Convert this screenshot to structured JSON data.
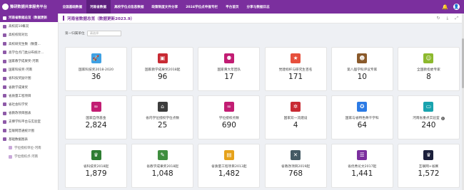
{
  "app": {
    "title": "豫研数据共享服务平台"
  },
  "nav": [
    {
      "label": "全国基础数据",
      "active": false
    },
    {
      "label": "河南省数据",
      "active": true
    },
    {
      "label": "高校学位点信息数据",
      "active": false
    },
    {
      "label": "政策制度文件分享",
      "active": false
    },
    {
      "label": "2024学位点申报专栏",
      "active": false
    },
    {
      "label": "平台首页",
      "active": false
    },
    {
      "label": "分享与数据日志",
      "active": false
    }
  ],
  "sidebar": [
    {
      "label": "河南省数据总览（数据更新",
      "active": true,
      "sub": false
    },
    {
      "label": "高校前10概况",
      "active": false,
      "sub": false
    },
    {
      "label": "高校校际对比",
      "active": false,
      "sub": false
    },
    {
      "label": "高校研究生数（数量...",
      "active": false,
      "sub": false
    },
    {
      "label": "高学位点门类分布统计...",
      "active": false,
      "sub": false
    },
    {
      "label": "国家教学成果奖-河南",
      "active": false,
      "sub": false
    },
    {
      "label": "国家科技奖-河南",
      "active": false,
      "sub": false
    },
    {
      "label": "省科技奖励计图",
      "active": false,
      "sub": false
    },
    {
      "label": "省教学成果奖",
      "active": false,
      "sub": false
    },
    {
      "label": "省质量工程项目",
      "active": false,
      "sub": false
    },
    {
      "label": "省社会科学奖",
      "active": false,
      "sub": false
    },
    {
      "label": "省教改项目图表",
      "active": false,
      "sub": false
    },
    {
      "label": "支撑学科平台与实验室",
      "active": false,
      "sub": false
    },
    {
      "label": "互联网普通统计图",
      "active": false,
      "sub": false
    },
    {
      "label": "基础数据图表",
      "active": false,
      "sub": false
    },
    {
      "label": "学位授权单位-河南",
      "active": false,
      "sub": true
    },
    {
      "label": "学位授权点-河南",
      "active": false,
      "sub": true
    }
  ],
  "page": {
    "title": "河南省数据总览（数据更新2023.9）"
  },
  "filter": {
    "label": "第一归属单位",
    "placeholder": "请选择"
  },
  "cards": [
    {
      "label": "国家科技奖2018-2020",
      "value": "36",
      "color": "#3fa1e3",
      "icon": "rocket-icon",
      "glyph": "🚀",
      "help": false
    },
    {
      "label": "国家教学成果奖2018起",
      "value": "96",
      "color": "#c82a33",
      "icon": "book-icon",
      "glyph": "▣",
      "help": false
    },
    {
      "label": "国家黄大年团队",
      "value": "17",
      "color": "#c21d73",
      "icon": "team-icon",
      "glyph": "⚉",
      "help": false
    },
    {
      "label": "党建标杆与研究生百名",
      "value": "171",
      "color": "#e64f3c",
      "icon": "award-icon",
      "glyph": "★",
      "help": false
    },
    {
      "label": "第八届学科评议专家",
      "value": "10",
      "color": "#8a5a2b",
      "icon": "experts-icon",
      "glyph": "☻",
      "help": false
    },
    {
      "label": "全国教指委专家",
      "value": "8",
      "color": "#8db92e",
      "icon": "user-icon",
      "glyph": "☺",
      "help": false
    },
    {
      "label": "国家自然基金",
      "value": "2,824",
      "color": "#c21d73",
      "icon": "link-icon",
      "glyph": "∞",
      "help": false
    },
    {
      "label": "省内学位授权学位点数",
      "value": "25",
      "color": "#3d3d3d",
      "icon": "graduation-cap-icon",
      "glyph": "⌂",
      "help": false
    },
    {
      "label": "学位授权点数",
      "value": "690",
      "color": "#c21d73",
      "icon": "link-icon",
      "glyph": "∞",
      "help": false
    },
    {
      "label": "国家双一流建设",
      "value": "4",
      "color": "#c82a33",
      "icon": "snowflake-icon",
      "glyph": "✲",
      "help": false
    },
    {
      "label": "国家与省特色骨干学科",
      "value": "64",
      "color": "#2c7be5",
      "icon": "badge-icon",
      "glyph": "✪",
      "help": false
    },
    {
      "label": "河南省重点实验室",
      "value": "240",
      "color": "#19a3ae",
      "icon": "tv-icon",
      "glyph": "▭",
      "help": true
    },
    {
      "label": "省科技奖2018起",
      "value": "1,879",
      "color": "#2e7d32",
      "icon": "trophy-icon",
      "glyph": "♛",
      "help": false
    },
    {
      "label": "省教学成果奖2018起",
      "value": "1,048",
      "color": "#3f8e3f",
      "icon": "book-edit-icon",
      "glyph": "✎",
      "help": false
    },
    {
      "label": "省质量工程项目2013起",
      "value": "1,482",
      "color": "#e6a21b",
      "icon": "chart-icon",
      "glyph": "▤",
      "help": false
    },
    {
      "label": "省教改项目2019起",
      "value": "768",
      "color": "#455a64",
      "icon": "tools-icon",
      "glyph": "✕",
      "help": false
    },
    {
      "label": "省优秀论文2017起",
      "value": "1,441",
      "color": "#7b2f9e",
      "icon": "document-icon",
      "glyph": "☰",
      "help": false
    },
    {
      "label": "互联网+省赛",
      "value": "1,572",
      "color": "#1b1f3b",
      "icon": "trophy-icon",
      "glyph": "♛",
      "help": false
    }
  ]
}
